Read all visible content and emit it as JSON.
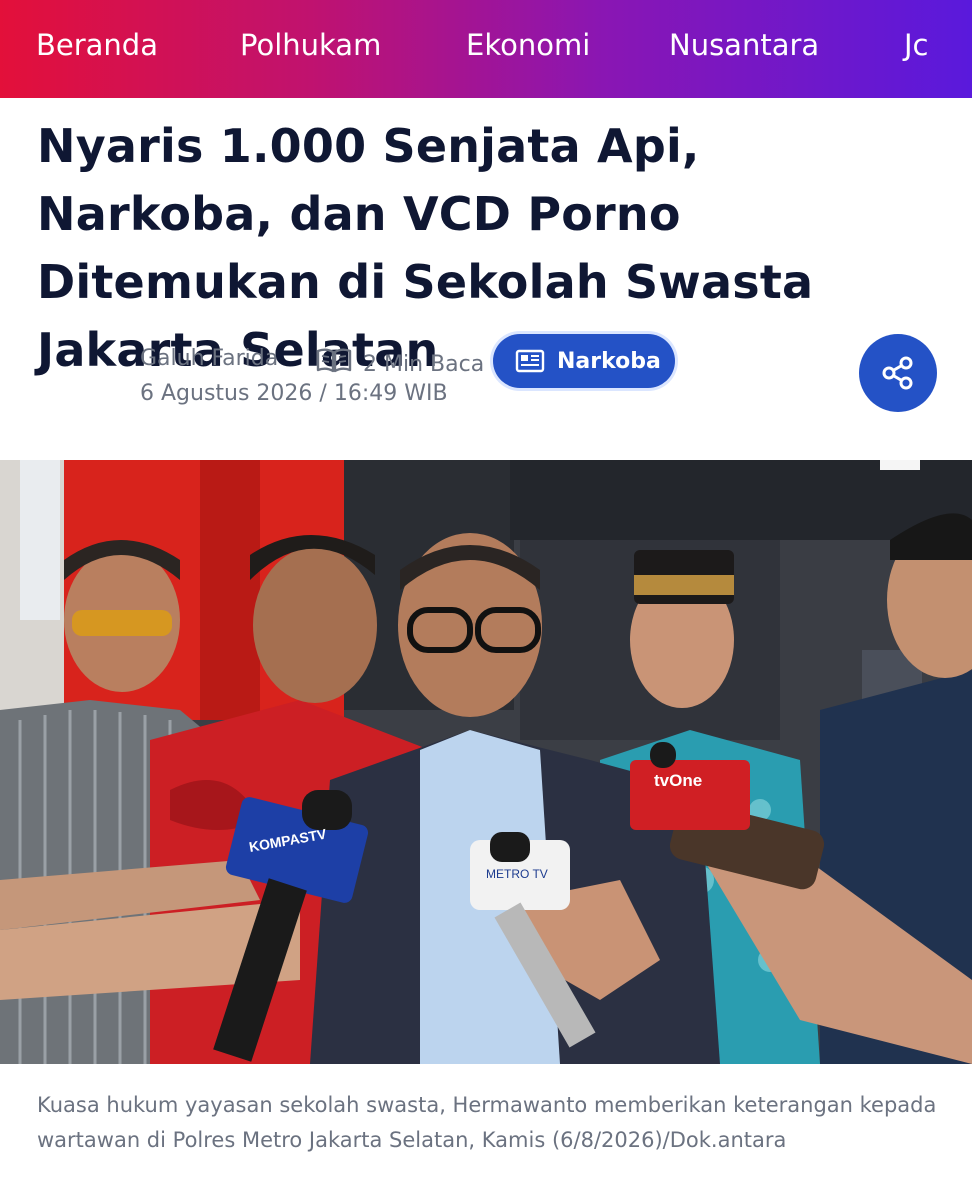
{
  "nav": {
    "items": [
      "Beranda",
      "Polhukam",
      "Ekonomi",
      "Nusantara",
      "Jc"
    ]
  },
  "article": {
    "title": "Nyaris 1.000 Senjata Api, Narkoba, dan VCD Porno Ditemukan di Sekolah Swasta Jakarta Selatan",
    "author": "Galuh Farida",
    "read_time": "2 Min Baca",
    "date": "6 Agustus 2026 / 16:49 WIB",
    "tag": "Narkoba",
    "caption": "Kuasa hukum yayasan sekolah swasta, Hermawanto memberikan keterangan kepada wartawan di Polres Metro Jakarta Selatan, Kamis (6/8/2026)/Dok.antara"
  },
  "photo": {
    "mic_labels": [
      "KOMPASTV",
      "METRO TV",
      "tvOne"
    ]
  },
  "icons": {
    "read": "open-book-icon",
    "tag": "newspaper-icon",
    "share": "share-icon"
  },
  "colors": {
    "nav_gradient_start": "#e3103a",
    "nav_gradient_end": "#5a19dc",
    "accent": "#2452c6",
    "title_text": "#0f1733",
    "muted_text": "#6b7280"
  }
}
